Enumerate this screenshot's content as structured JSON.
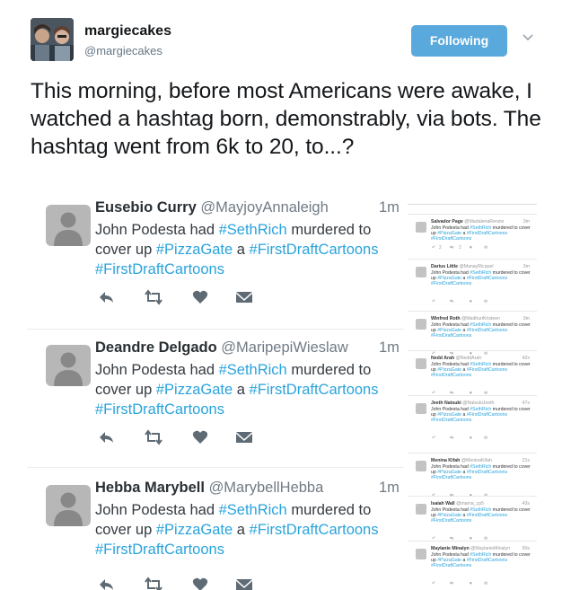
{
  "tweet": {
    "display_name": "margiecakes",
    "handle": "@margiecakes",
    "follow_label": "Following",
    "text": "This morning, before most Americans were awake, I watched a hashtag born, demonstrably, via bots. The hashtag went from 6k to 20, to...?"
  },
  "embedded": {
    "tweets": [
      {
        "name": "Eusebio Curry",
        "handle": "@MayjoyAnnaleigh",
        "time": "1m",
        "body_pre": "John Podesta had ",
        "tag1": "#SethRich",
        "mid1": " murdered to cover up ",
        "tag2": "#PizzaGate",
        "mid2": " a ",
        "tag3": "#FirstDraftCartoons",
        "mid3": " ",
        "tag4": "#FirstDraftCartoons"
      },
      {
        "name": "Deandre Delgado",
        "handle": "@MaripepiWieslaw",
        "time": "1m",
        "body_pre": "John Podesta had ",
        "tag1": "#SethRich",
        "mid1": " murdered to cover up ",
        "tag2": "#PizzaGate",
        "mid2": " a ",
        "tag3": "#FirstDraftCartoons",
        "mid3": " ",
        "tag4": "#FirstDraftCartoons"
      },
      {
        "name": "Hebba Marybell",
        "handle": "@MarybellHebba",
        "time": "1m",
        "body_pre": "John Podesta had ",
        "tag1": "#SethRich",
        "mid1": " murdered to cover up ",
        "tag2": "#PizzaGate",
        "mid2": " a ",
        "tag3": "#FirstDraftCartoons",
        "mid3": " ",
        "tag4": "#FirstDraftCartoons"
      }
    ],
    "side_tweets": [
      {
        "name": "Salvador Page",
        "handle": "@MadalenaRenzie",
        "time": "3m",
        "reply_count": "2",
        "retweet_count": "2"
      },
      {
        "name": "Darius Little",
        "handle": "@ManayRicquel",
        "time": "3m",
        "reply_count": "",
        "retweet_count": ""
      },
      {
        "name": "Winfred Roth",
        "handle": "@MadhuriKristeen",
        "time": "3m",
        "reply_count": "",
        "retweet_count": ""
      },
      {
        "name": "Nedd Arah",
        "handle": "@NeddArah",
        "time": "42s",
        "reply_count": "",
        "retweet_count": ""
      },
      {
        "name": "Jeeth Natsuki",
        "handle": "@NatsukiJeeth",
        "time": "47s",
        "reply_count": "",
        "retweet_count": ""
      },
      {
        "name": "Menina Kifah",
        "handle": "@MeninaKifah",
        "time": "21s",
        "reply_count": "",
        "retweet_count": ""
      },
      {
        "name": "Isaiah Wall",
        "handle": "@mama_cp5",
        "time": "43s",
        "reply_count": "",
        "retweet_count": ""
      },
      {
        "name": "Maylanie Minalyn",
        "handle": "@MaylanieMinalyn",
        "time": "50s",
        "reply_count": "",
        "retweet_count": ""
      }
    ],
    "side_body_pre": "John Podesta had ",
    "side_tag1": "#SethRich",
    "side_mid1": " murdered to cover up ",
    "side_tag2": "#PizzaGate",
    "side_mid2": " a ",
    "side_tag3": "#FirstDraftCartoons",
    "side_tag4": "#FirstDraftCartoons"
  },
  "colors": {
    "follow_button": "#5aa9dd",
    "hashtag": "#2aa3dc"
  }
}
